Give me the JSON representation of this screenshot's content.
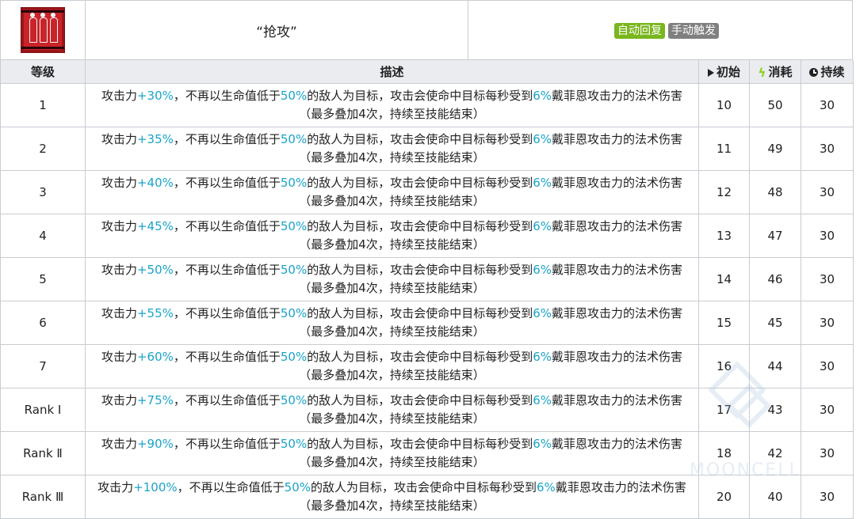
{
  "skill": {
    "name": "“抢攻”",
    "icon": "skill-icon-red-figures",
    "tags": [
      {
        "label": "自动回复",
        "color": "#7ab61d"
      },
      {
        "label": "手动触发",
        "color": "#808080"
      }
    ]
  },
  "table": {
    "headers": {
      "level": "等级",
      "description": "描述",
      "initial": "初始",
      "cost": "消耗",
      "duration": "持续"
    },
    "rows": [
      {
        "level": "1",
        "atk": "+30%",
        "desc_a": "攻击力",
        "desc_b": "，不再以生命值低于",
        "hp": "50%",
        "desc_c": "的敌人为目标，攻击会使命中目标每秒受到",
        "dmg": "6%",
        "desc_d": "戴菲恩攻击力的法术伤害（最多叠加4次，持续至技能结束）",
        "initial": "10",
        "cost": "50",
        "duration": "30"
      },
      {
        "level": "2",
        "atk": "+35%",
        "desc_a": "攻击力",
        "desc_b": "，不再以生命值低于",
        "hp": "50%",
        "desc_c": "的敌人为目标，攻击会使命中目标每秒受到",
        "dmg": "6%",
        "desc_d": "戴菲恩攻击力的法术伤害（最多叠加4次，持续至技能结束）",
        "initial": "11",
        "cost": "49",
        "duration": "30"
      },
      {
        "level": "3",
        "atk": "+40%",
        "desc_a": "攻击力",
        "desc_b": "，不再以生命值低于",
        "hp": "50%",
        "desc_c": "的敌人为目标，攻击会使命中目标每秒受到",
        "dmg": "6%",
        "desc_d": "戴菲恩攻击力的法术伤害（最多叠加4次，持续至技能结束）",
        "initial": "12",
        "cost": "48",
        "duration": "30"
      },
      {
        "level": "4",
        "atk": "+45%",
        "desc_a": "攻击力",
        "desc_b": "，不再以生命值低于",
        "hp": "50%",
        "desc_c": "的敌人为目标，攻击会使命中目标每秒受到",
        "dmg": "6%",
        "desc_d": "戴菲恩攻击力的法术伤害（最多叠加4次，持续至技能结束）",
        "initial": "13",
        "cost": "47",
        "duration": "30"
      },
      {
        "level": "5",
        "atk": "+50%",
        "desc_a": "攻击力",
        "desc_b": "，不再以生命值低于",
        "hp": "50%",
        "desc_c": "的敌人为目标，攻击会使命中目标每秒受到",
        "dmg": "6%",
        "desc_d": "戴菲恩攻击力的法术伤害（最多叠加4次，持续至技能结束）",
        "initial": "14",
        "cost": "46",
        "duration": "30"
      },
      {
        "level": "6",
        "atk": "+55%",
        "desc_a": "攻击力",
        "desc_b": "，不再以生命值低于",
        "hp": "50%",
        "desc_c": "的敌人为目标，攻击会使命中目标每秒受到",
        "dmg": "6%",
        "desc_d": "戴菲恩攻击力的法术伤害（最多叠加4次，持续至技能结束）",
        "initial": "15",
        "cost": "45",
        "duration": "30"
      },
      {
        "level": "7",
        "atk": "+60%",
        "desc_a": "攻击力",
        "desc_b": "，不再以生命值低于",
        "hp": "50%",
        "desc_c": "的敌人为目标，攻击会使命中目标每秒受到",
        "dmg": "6%",
        "desc_d": "戴菲恩攻击力的法术伤害（最多叠加4次，持续至技能结束）",
        "initial": "16",
        "cost": "44",
        "duration": "30"
      },
      {
        "level": "Rank Ⅰ",
        "atk": "+75%",
        "desc_a": "攻击力",
        "desc_b": "，不再以生命值低于",
        "hp": "50%",
        "desc_c": "的敌人为目标，攻击会使命中目标每秒受到",
        "dmg": "6%",
        "desc_d": "戴菲恩攻击力的法术伤害（最多叠加4次，持续至技能结束）",
        "initial": "17",
        "cost": "43",
        "duration": "30"
      },
      {
        "level": "Rank Ⅱ",
        "atk": "+90%",
        "desc_a": "攻击力",
        "desc_b": "，不再以生命值低于",
        "hp": "50%",
        "desc_c": "的敌人为目标，攻击会使命中目标每秒受到",
        "dmg": "6%",
        "desc_d": "戴菲恩攻击力的法术伤害（最多叠加4次，持续至技能结束）",
        "initial": "18",
        "cost": "42",
        "duration": "30"
      },
      {
        "level": "Rank Ⅲ",
        "atk": "+100%",
        "desc_a": "攻击力",
        "desc_b": "，不再以生命值低于",
        "hp": "50%",
        "desc_c": "的敌人为目标，攻击会使命中目标每秒受到",
        "dmg": "6%",
        "desc_d": "戴菲恩攻击力的法术伤害（最多叠加4次，持续至技能结束）",
        "initial": "20",
        "cost": "40",
        "duration": "30"
      }
    ]
  },
  "watermark": {
    "text": "MOONCELL",
    "icon": "mooncell-logo"
  },
  "colors": {
    "highlight": "#1aa3c9",
    "header_bg": "#eaecf0",
    "border": "#c8ccd1"
  }
}
